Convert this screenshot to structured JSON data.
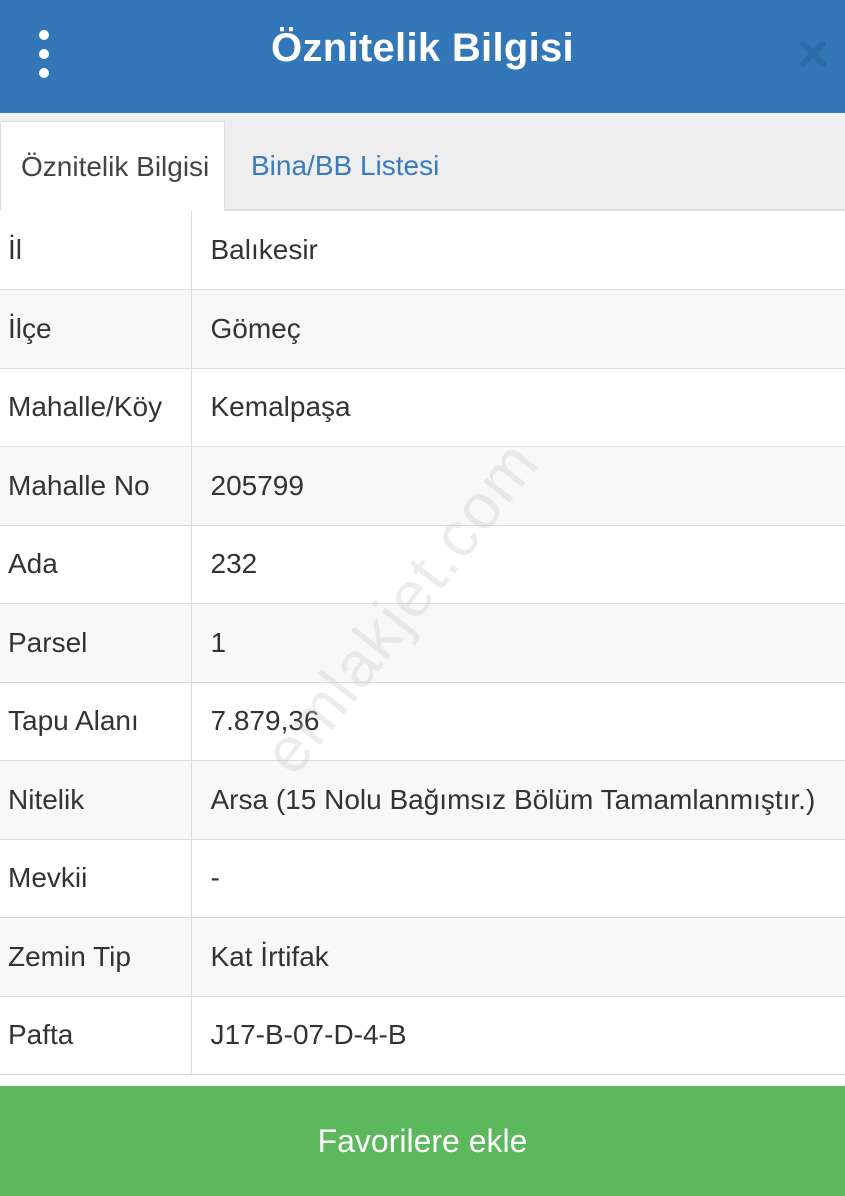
{
  "header": {
    "title": "Öznitelik Bilgisi",
    "menu_icon": "more-vertical-icon",
    "close_icon": "close-icon"
  },
  "tabs": [
    {
      "label": "Öznitelik Bilgisi",
      "active": true
    },
    {
      "label": "Bina/BB Listesi",
      "active": false
    }
  ],
  "attributes": [
    {
      "key": "İl",
      "value": "Balıkesir"
    },
    {
      "key": "İlçe",
      "value": "Gömeç"
    },
    {
      "key": "Mahalle/Köy",
      "value": "Kemalpaşa"
    },
    {
      "key": "Mahalle No",
      "value": "205799"
    },
    {
      "key": "Ada",
      "value": "232"
    },
    {
      "key": "Parsel",
      "value": "1"
    },
    {
      "key": "Tapu Alanı",
      "value": "7.879,36"
    },
    {
      "key": "Nitelik",
      "value": "Arsa (15 Nolu Bağımsız Bölüm Tamamlanmıştır.)"
    },
    {
      "key": "Mevkii",
      "value": "-"
    },
    {
      "key": "Zemin Tip",
      "value": "Kat İrtifak"
    },
    {
      "key": "Pafta",
      "value": "J17-B-07-D-4-B"
    }
  ],
  "footer": {
    "favorite_label": "Favorilere ekle"
  },
  "watermark": "emlakjet.com",
  "colors": {
    "header": "#3377b9",
    "tab_link": "#3a7bbf",
    "button": "#5cb85c",
    "close_icon": "#2d6aa6"
  }
}
